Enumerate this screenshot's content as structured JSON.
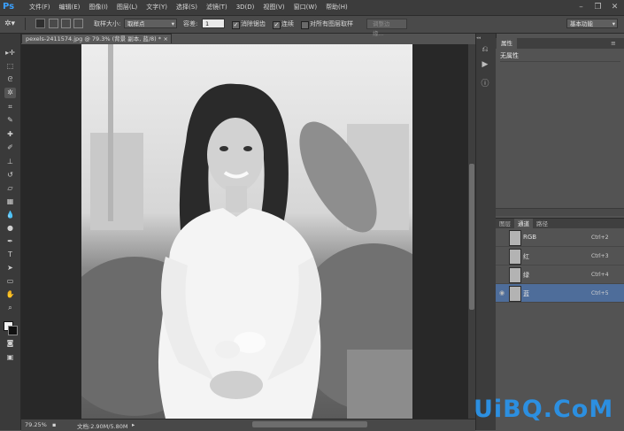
{
  "app": {
    "logo": "Ps"
  },
  "menubar": {
    "items": [
      "文件(F)",
      "编辑(E)",
      "图像(I)",
      "图层(L)",
      "文字(Y)",
      "选择(S)",
      "滤镜(T)",
      "3D(D)",
      "视图(V)",
      "窗口(W)",
      "帮助(H)"
    ],
    "window_controls": [
      "minimize-icon",
      "restore-icon",
      "close-icon"
    ]
  },
  "options": {
    "sample_size_label": "取样大小:",
    "sample_size_value": "取样点",
    "tolerance_label": "容差:",
    "tolerance_value": "1",
    "antialias_label": "消除锯齿",
    "antialias_checked": true,
    "contiguous_label": "连续",
    "contiguous_checked": true,
    "all_layers_label": "对所有图层取样",
    "all_layers_checked": false,
    "refine_edge_label": "调整边缘...",
    "workspace": "基本功能"
  },
  "document": {
    "tab_title": "pexels-2411574.jpg @ 79.3% (背景 副本, 蓝/8) *",
    "zoom": "79.25%",
    "doc_size": "文档:2.90M/5.80M"
  },
  "properties": {
    "tab": "属性",
    "no_properties": "无属性"
  },
  "layers_panel": {
    "tabs": [
      "图层",
      "通道",
      "路径"
    ],
    "active_tab": "通道",
    "channels": [
      {
        "name": "RGB",
        "shortcut": "Ctrl+2",
        "visible": false,
        "selected": false
      },
      {
        "name": "红",
        "shortcut": "Ctrl+3",
        "visible": false,
        "selected": false
      },
      {
        "name": "绿",
        "shortcut": "Ctrl+4",
        "visible": false,
        "selected": false
      },
      {
        "name": "蓝",
        "shortcut": "Ctrl+5",
        "visible": true,
        "selected": true
      }
    ]
  },
  "watermark": {
    "text": "UiBQ.CoM"
  },
  "colors": {
    "accent_selected": "#4e6d9a",
    "ps_blue": "#3aa0ff"
  }
}
